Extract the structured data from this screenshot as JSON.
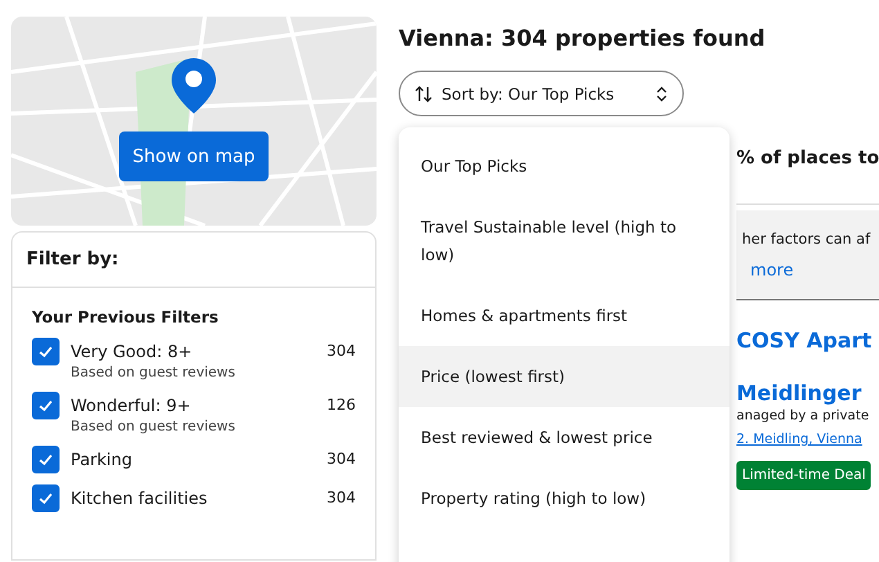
{
  "map": {
    "button": "Show on map"
  },
  "filters": {
    "title": "Filter by:",
    "section": "Your Previous Filters",
    "items": [
      {
        "label": "Very Good: 8+",
        "note": "Based on guest reviews",
        "count": "304",
        "checked": true
      },
      {
        "label": "Wonderful: 9+",
        "note": "Based on guest reviews",
        "count": "126",
        "checked": true
      },
      {
        "label": "Parking",
        "count": "304",
        "checked": true
      },
      {
        "label": "Kitchen facilities",
        "count": "304",
        "checked": true
      }
    ]
  },
  "results": {
    "title": "Vienna: 304 properties found",
    "sort_button": "Sort by: Our Top Picks"
  },
  "sort_menu": [
    {
      "label": "Our Top Picks",
      "highlighted": false
    },
    {
      "label": "Travel Sustainable level (high to low)",
      "highlighted": false
    },
    {
      "label": "Homes & apartments first",
      "highlighted": false
    },
    {
      "label": "Price (lowest first)",
      "highlighted": true
    },
    {
      "label": "Best reviewed & lowest price",
      "highlighted": false
    },
    {
      "label": "Property rating (high to low)",
      "highlighted": false
    }
  ],
  "banner": {
    "heading": "% of places to",
    "text": "her factors can af",
    "link": "more"
  },
  "listing": {
    "name_line_1": "COSY Apart",
    "name_line_2": "Meidlinger",
    "manager": "anaged by a private",
    "location": "2. Meidling, Vienna",
    "badge": "Limited-time Deal"
  }
}
